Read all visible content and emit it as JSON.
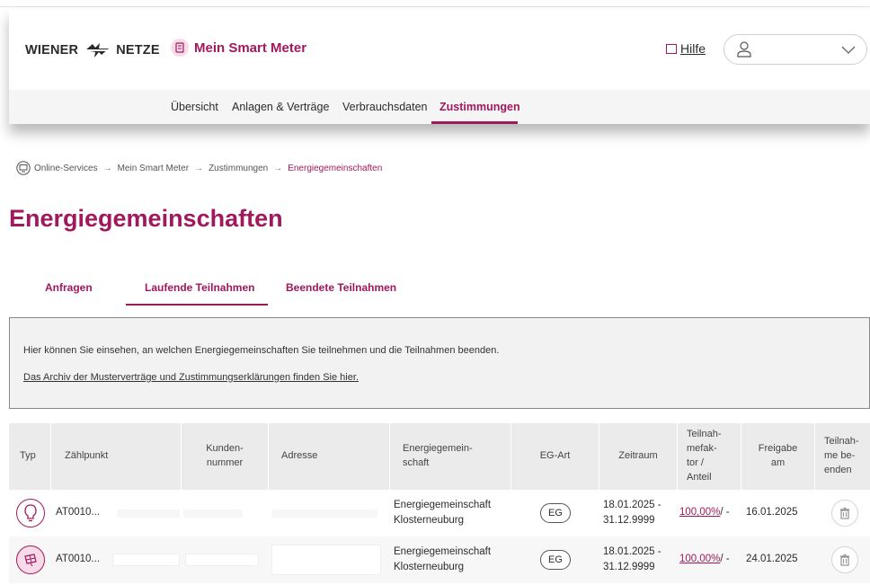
{
  "header": {
    "brand_left": "WIENER",
    "brand_right": "NETZE",
    "app_name": "Mein Smart Meter",
    "help_label": "Hilfe"
  },
  "nav": {
    "items": [
      {
        "label": "Übersicht"
      },
      {
        "label": "Anlagen & Verträge"
      },
      {
        "label": "Verbrauchsdaten"
      },
      {
        "label": "Zustimmungen"
      }
    ],
    "active": "Zustimmungen"
  },
  "breadcrumb": {
    "items": [
      "Online-Services",
      "Mein Smart Meter",
      "Zustimmungen",
      "Energiegemeinschaften"
    ],
    "separator": "→"
  },
  "page": {
    "title": "Energiegemeinschaften"
  },
  "tabs": {
    "items": [
      "Anfragen",
      "Laufende Teilnahmen",
      "Beendete Teilnahmen"
    ],
    "active": "Laufende Teilnahmen"
  },
  "info": {
    "text": "Hier können Sie einsehen, an welchen Energiegemeinschaften Sie teilnehmen und die Teilnahmen beenden.",
    "link": "Das Archiv der Musterverträge und Zustimmungserklärungen finden Sie hier."
  },
  "table": {
    "headers": {
      "typ": "Typ",
      "zaehlpunkt": "Zählpunkt",
      "kundennummer_1": "Kunden-",
      "kundennummer_2": "nummer",
      "adresse": "Adresse",
      "eg_1": "Energiegemein-",
      "eg_2": "schaft",
      "art": "EG-Art",
      "zeitraum": "Zeitraum",
      "faktor_1": "Teilnah-",
      "faktor_2": "mefak-",
      "faktor_3": "tor /",
      "faktor_4": "Anteil",
      "freigabe_1": "Freigabe",
      "freigabe_2": "am",
      "beenden_1": "Teilnah-",
      "beenden_2": "me be-",
      "beenden_3": "enden"
    },
    "rows": [
      {
        "type_icon": "lightbulb-icon",
        "zaehlpunkt": "AT0010...",
        "eg_1": "Energiegemeinschaft",
        "eg_2": "Klosterneuburg",
        "art": "EG",
        "zeitraum_1": "18.01.2025 -",
        "zeitraum_2": "31.12.9999",
        "anteil_pct": "100,00%",
        "anteil_rest": " / -",
        "freigabe": "16.01.2025"
      },
      {
        "type_icon": "solar-panel-icon",
        "zaehlpunkt": "AT0010...",
        "eg_1": "Energiegemeinschaft",
        "eg_2": "Klosterneuburg",
        "art": "EG",
        "zeitraum_1": "18.01.2025 -",
        "zeitraum_2": "31.12.9999",
        "anteil_pct": "100,00%",
        "anteil_rest": " / -",
        "freigabe": "24.01.2025"
      }
    ]
  },
  "colors": {
    "accent": "#a1195d",
    "accent_light": "#f7dbe8",
    "nav_bg": "#f5f5f5",
    "info_bg": "#f2f2f2",
    "table_header_bg": "#ebebeb"
  }
}
